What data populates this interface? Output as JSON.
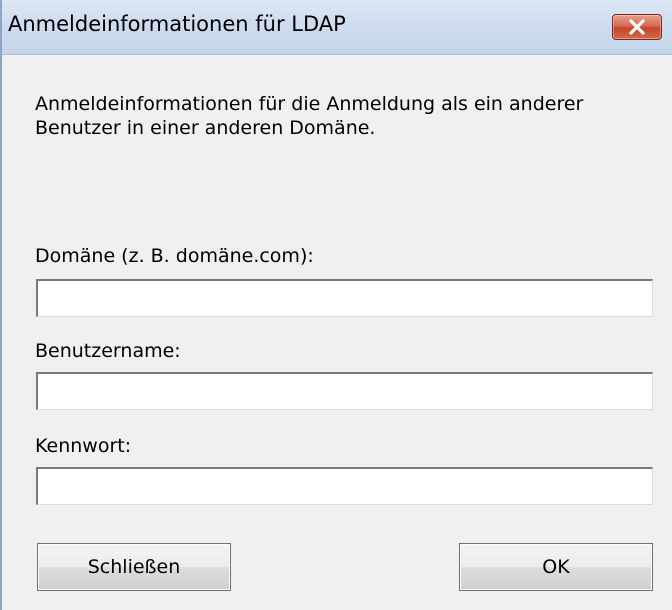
{
  "window": {
    "title": "Anmeldeinformationen für LDAP",
    "close_icon": "close-icon"
  },
  "description": "Anmeldeinformationen für die Anmeldung als ein anderer Benutzer in einer anderen Domäne.",
  "fields": {
    "domain": {
      "label": "Domäne (z. B. domäne.com):",
      "value": ""
    },
    "username": {
      "label": "Benutzername:",
      "value": ""
    },
    "password": {
      "label": "Kennwort:",
      "value": ""
    }
  },
  "buttons": {
    "close_label": "Schließen",
    "ok_label": "OK"
  },
  "colors": {
    "titlebar": "#cfdcee",
    "close_button": "#c4452c",
    "dialog_background": "#f0f0f0"
  }
}
